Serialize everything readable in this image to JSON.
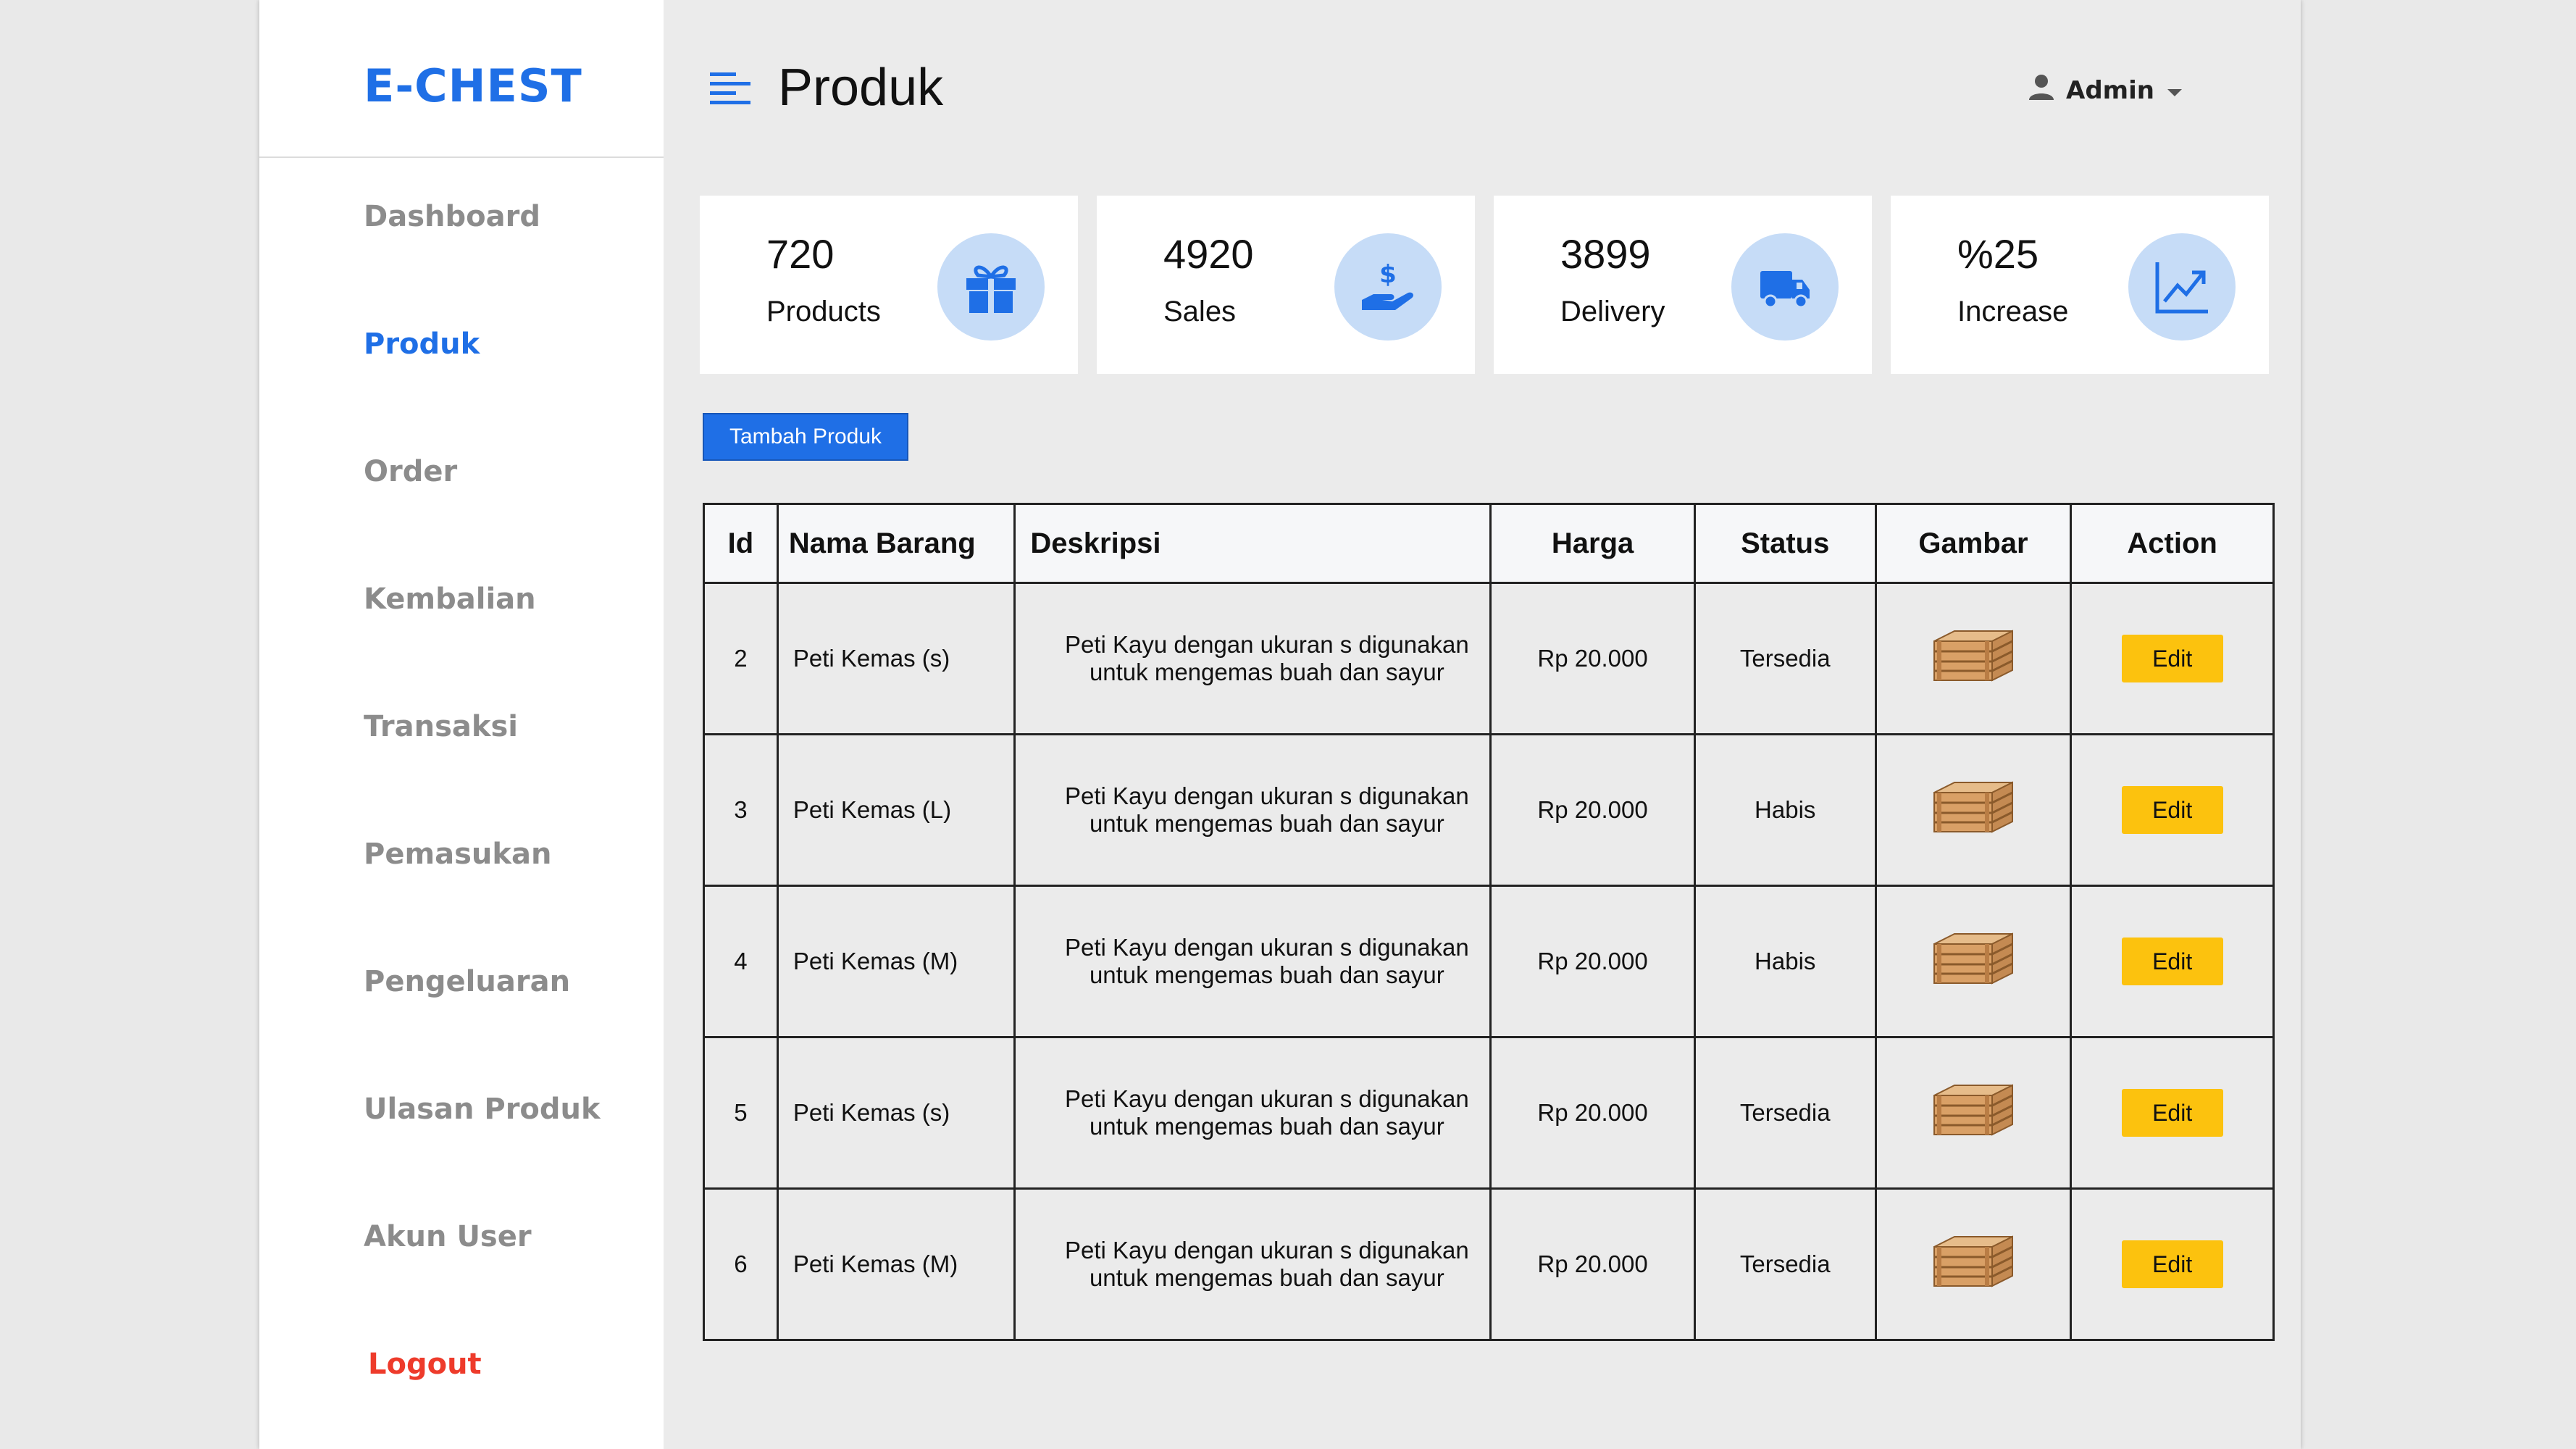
{
  "brand": "E-CHEST",
  "page_title": "Produk",
  "user": {
    "name": "Admin"
  },
  "sidebar": {
    "items": [
      {
        "label": "Dashboard",
        "active": false
      },
      {
        "label": "Produk",
        "active": true
      },
      {
        "label": "Order",
        "active": false
      },
      {
        "label": "Kembalian",
        "active": false
      },
      {
        "label": "Transaksi",
        "active": false
      },
      {
        "label": "Pemasukan",
        "active": false
      },
      {
        "label": "Pengeluaran",
        "active": false
      },
      {
        "label": "Ulasan Produk",
        "active": false
      },
      {
        "label": "Akun User",
        "active": false
      }
    ],
    "logout": "Logout"
  },
  "stats": [
    {
      "value": "720",
      "label": "Products",
      "icon": "gift-icon"
    },
    {
      "value": "4920",
      "label": "Sales",
      "icon": "hand-dollar-icon"
    },
    {
      "value": "3899",
      "label": "Delivery",
      "icon": "truck-icon"
    },
    {
      "value": "%25",
      "label": "Increase",
      "icon": "trend-up-icon"
    }
  ],
  "add_button": "Tambah Produk",
  "table": {
    "headers": [
      "Id",
      "Nama Barang",
      "Deskripsi",
      "Harga",
      "Status",
      "Gambar",
      "Action"
    ],
    "rows": [
      {
        "id": "2",
        "name": "Peti Kemas (s)",
        "desc1": "Peti Kayu dengan ukuran s digunakan",
        "desc2": "untuk mengemas buah dan sayur",
        "price": "Rp 20.000",
        "status": "Tersedia",
        "action": "Edit"
      },
      {
        "id": "3",
        "name": "Peti Kemas (L)",
        "desc1": "Peti Kayu dengan ukuran s digunakan",
        "desc2": "untuk mengemas buah dan sayur",
        "price": "Rp 20.000",
        "status": "Habis",
        "action": "Edit"
      },
      {
        "id": "4",
        "name": "Peti Kemas (M)",
        "desc1": "Peti Kayu dengan ukuran s digunakan",
        "desc2": "untuk mengemas buah dan sayur",
        "price": "Rp 20.000",
        "status": "Habis",
        "action": "Edit"
      },
      {
        "id": "5",
        "name": "Peti Kemas (s)",
        "desc1": "Peti Kayu dengan ukuran s digunakan",
        "desc2": "untuk mengemas buah dan sayur",
        "price": "Rp 20.000",
        "status": "Tersedia",
        "action": "Edit"
      },
      {
        "id": "6",
        "name": "Peti Kemas (M)",
        "desc1": "Peti Kayu dengan ukuran s digunakan",
        "desc2": "untuk mengemas buah dan sayur",
        "price": "Rp 20.000",
        "status": "Tersedia",
        "action": "Edit"
      }
    ]
  },
  "colors": {
    "brand": "#1f6fe6",
    "logout": "#ee3b2b",
    "edit_button": "#fcc20e",
    "icon_circle": "#c6dcf7"
  }
}
